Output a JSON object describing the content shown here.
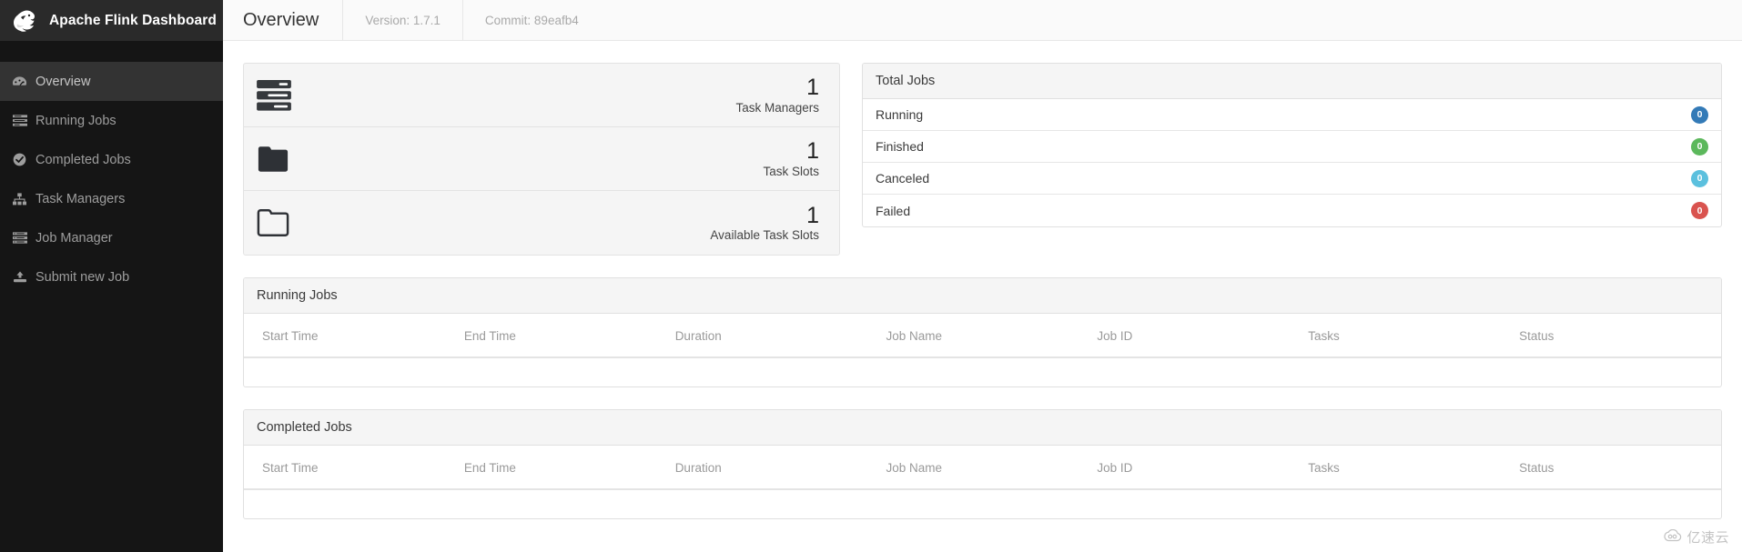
{
  "sidebar": {
    "brand": {
      "title": "Apache Flink Dashboard",
      "logo_icon": "flink-squirrel-icon"
    },
    "items": [
      {
        "label": "Overview",
        "icon": "dashboard-icon",
        "active": true
      },
      {
        "label": "Running Jobs",
        "icon": "list-running-icon",
        "active": false
      },
      {
        "label": "Completed Jobs",
        "icon": "check-circle-icon",
        "active": false
      },
      {
        "label": "Task Managers",
        "icon": "sitemap-icon",
        "active": false
      },
      {
        "label": "Job Manager",
        "icon": "server-list-icon",
        "active": false
      },
      {
        "label": "Submit new Job",
        "icon": "upload-icon",
        "active": false
      }
    ]
  },
  "topbar": {
    "title": "Overview",
    "version": "Version: 1.7.1",
    "commit": "Commit: 89eafb4"
  },
  "stats": [
    {
      "icon": "server-stack-icon",
      "value": "1",
      "label": "Task Managers"
    },
    {
      "icon": "folder-filled-icon",
      "value": "1",
      "label": "Task Slots"
    },
    {
      "icon": "folder-open-icon",
      "value": "1",
      "label": "Available Task Slots"
    }
  ],
  "total_jobs": {
    "title": "Total Jobs",
    "rows": [
      {
        "label": "Running",
        "count": "0",
        "color": "#337ab7"
      },
      {
        "label": "Finished",
        "count": "0",
        "color": "#5cb85c"
      },
      {
        "label": "Canceled",
        "count": "0",
        "color": "#5bc0de"
      },
      {
        "label": "Failed",
        "count": "0",
        "color": "#d9534f"
      }
    ]
  },
  "running_jobs": {
    "title": "Running Jobs",
    "columns": [
      "Start Time",
      "End Time",
      "Duration",
      "Job Name",
      "Job ID",
      "Tasks",
      "Status"
    ],
    "rows": []
  },
  "completed_jobs": {
    "title": "Completed Jobs",
    "columns": [
      "Start Time",
      "End Time",
      "Duration",
      "Job Name",
      "Job ID",
      "Tasks",
      "Status"
    ],
    "rows": []
  },
  "watermark": {
    "text": "亿速云",
    "icon": "cloud-icon"
  }
}
